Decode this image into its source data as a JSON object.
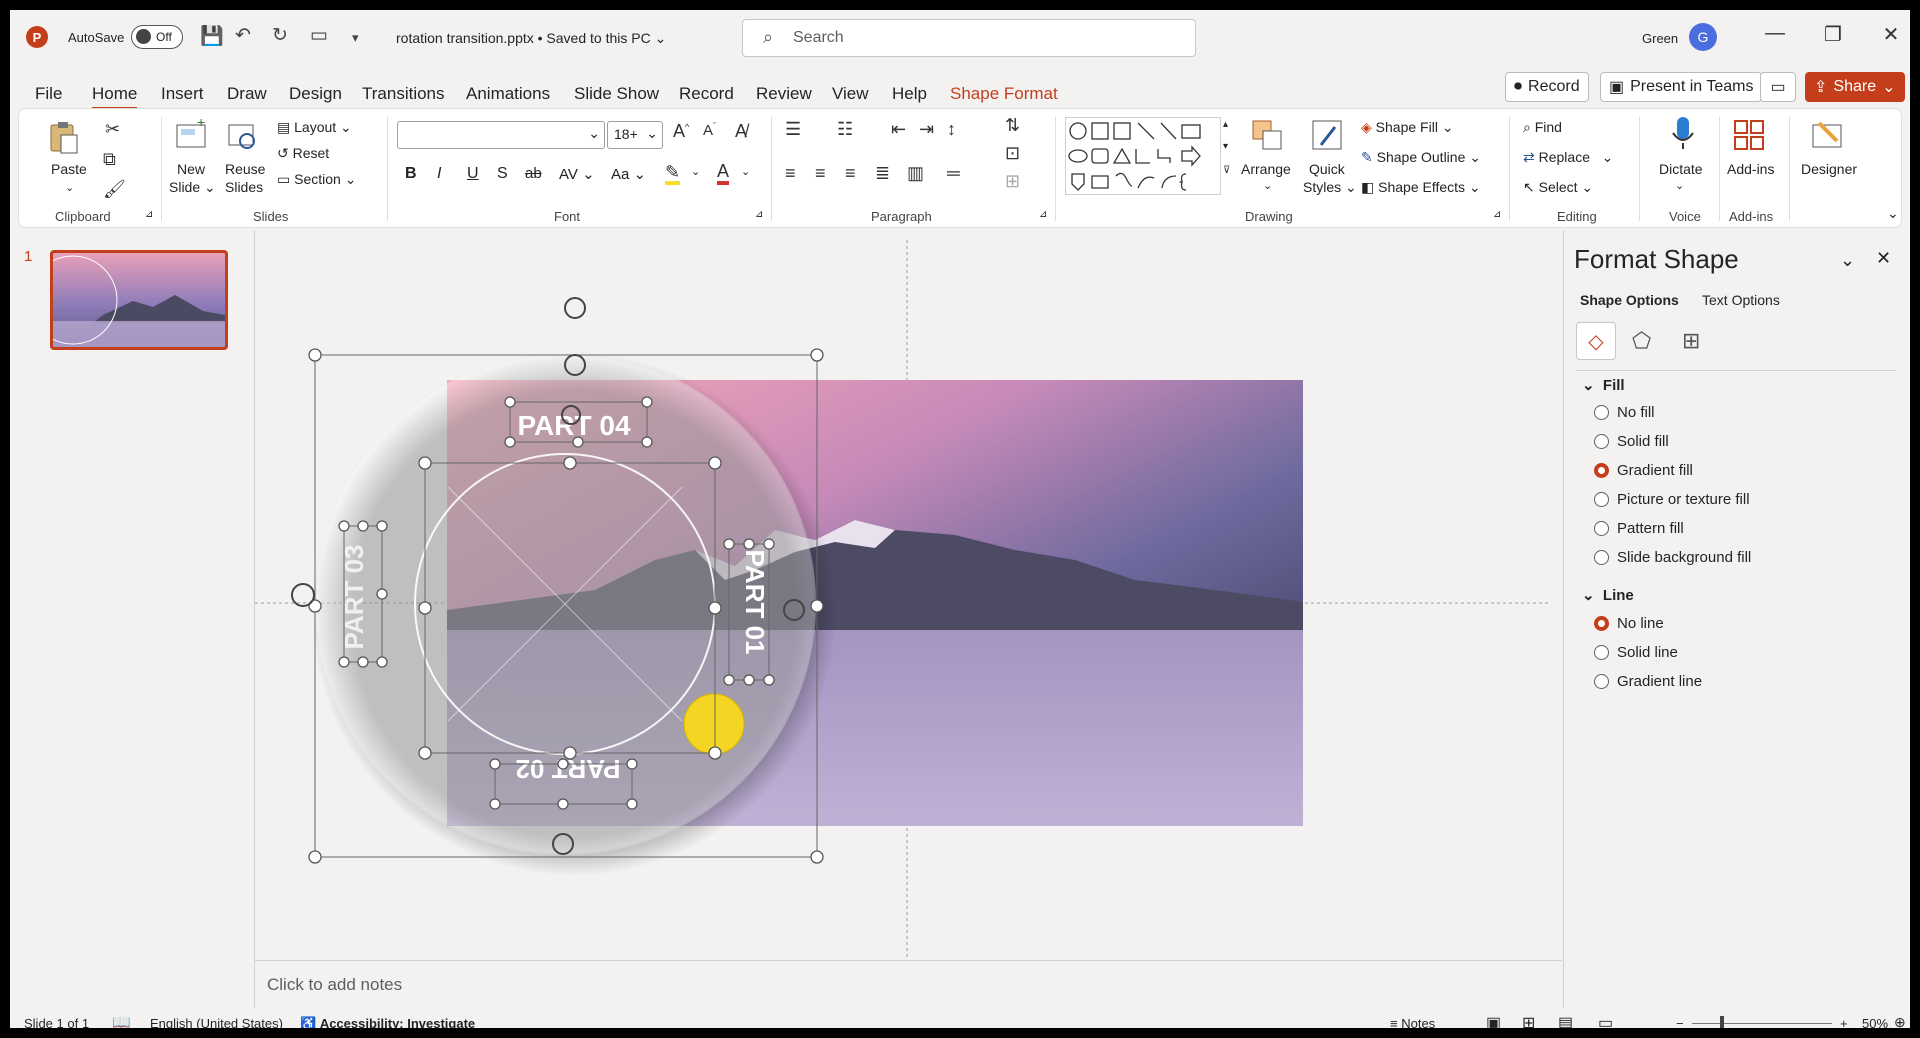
{
  "titlebar": {
    "autosave_label": "AutoSave",
    "autosave_state": "Off",
    "document_title": "rotation transition.pptx • Saved to this PC",
    "search_placeholder": "Search",
    "user_name": "Green",
    "user_initial": "G"
  },
  "tabs": [
    "File",
    "Home",
    "Insert",
    "Draw",
    "Design",
    "Transitions",
    "Animations",
    "Slide Show",
    "Record",
    "Review",
    "View",
    "Help",
    "Shape Format"
  ],
  "active_tab": "Home",
  "right_buttons": {
    "record": "Record",
    "present": "Present in Teams",
    "share": "Share"
  },
  "ribbon": {
    "clipboard": {
      "paste": "Paste",
      "label": "Clipboard"
    },
    "slides": {
      "new_slide_1": "New",
      "new_slide_2": "Slide",
      "reuse_1": "Reuse",
      "reuse_2": "Slides",
      "layout": "Layout",
      "reset": "Reset",
      "section": "Section",
      "label": "Slides"
    },
    "font": {
      "font_name": "",
      "font_size": "18+",
      "bold": "B",
      "italic": "I",
      "underline": "U",
      "shadow": "S",
      "strike": "ab",
      "spacing": "AV",
      "case": "Aa",
      "label": "Font"
    },
    "paragraph": {
      "label": "Paragraph"
    },
    "drawing": {
      "arrange": "Arrange",
      "quick_1": "Quick",
      "quick_2": "Styles",
      "shape_fill": "Shape Fill",
      "shape_outline": "Shape Outline",
      "shape_effects": "Shape Effects",
      "label": "Drawing"
    },
    "editing": {
      "find": "Find",
      "replace": "Replace",
      "select": "Select",
      "label": "Editing"
    },
    "voice": {
      "dictate": "Dictate",
      "label": "Voice"
    },
    "addins": {
      "addins": "Add-ins",
      "label": "Add-ins"
    },
    "designer": {
      "designer": "Designer"
    }
  },
  "thumbnails": [
    {
      "number": "1"
    }
  ],
  "slide": {
    "labels": [
      "PART 04",
      "PART 03",
      "PART 01",
      "PART 02"
    ]
  },
  "notes_placeholder": "Click to add notes",
  "format_pane": {
    "title": "Format Shape",
    "tab_shape": "Shape Options",
    "tab_text": "Text Options",
    "fill_section": "Fill",
    "fill_options": [
      "No fill",
      "Solid fill",
      "Gradient fill",
      "Picture or texture fill",
      "Pattern fill",
      "Slide background fill"
    ],
    "fill_selected": "Gradient fill",
    "line_section": "Line",
    "line_options": [
      "No line",
      "Solid line",
      "Gradient line"
    ],
    "line_selected": "No line"
  },
  "statusbar": {
    "slide_info": "Slide 1 of 1",
    "language": "English (United States)",
    "accessibility": "Accessibility: Investigate",
    "notes": "Notes",
    "zoom": "50%"
  },
  "colors": {
    "accent": "#c43e1c",
    "selection_yellow": "#f5d523"
  }
}
